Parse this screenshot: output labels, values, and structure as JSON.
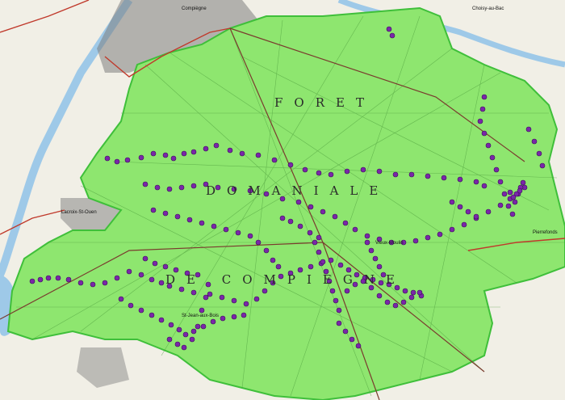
{
  "map": {
    "forest_label": {
      "line1": "FORET",
      "line2": "DOMANIALE",
      "line3": "DE COMPIEGNE"
    },
    "places": {
      "lacroix": "Lacroix-St-Ouen",
      "pierrefonds": "Pierrefonds",
      "vieux_moulin": "Vieux-Moulin",
      "saint_jean": "St-Jean-aux-Bois",
      "compiegne": "Compiègne",
      "choisy": "Choisy-au-Bac"
    },
    "colors": {
      "forest_fill": "#8ee66f",
      "forest_edge": "#3fbf3a",
      "road_main": "#c0392b",
      "rail": "#7a3b2e",
      "water": "#9ec9e8",
      "urban": "#6b6b6b",
      "point_marker": "#7a27a8"
    },
    "point_count": 196
  }
}
